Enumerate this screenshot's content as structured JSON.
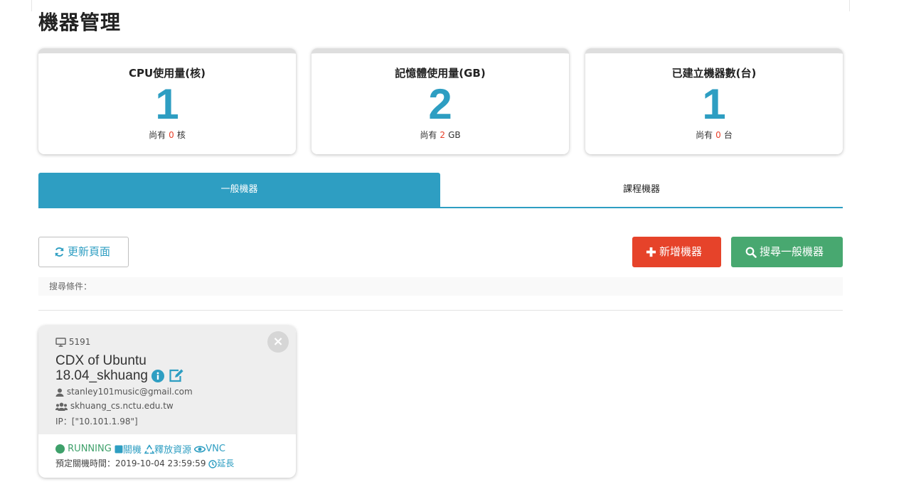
{
  "page": {
    "title": "機器管理"
  },
  "stats": [
    {
      "title": "CPU使用量(核)",
      "value": "1",
      "remain_prefix": "尚有",
      "remain_value": "0",
      "remain_unit": "核"
    },
    {
      "title": "記憶體使用量(GB)",
      "value": "2",
      "remain_prefix": "尚有",
      "remain_value": "2",
      "remain_unit": "GB"
    },
    {
      "title": "已建立機器數(台)",
      "value": "1",
      "remain_prefix": "尚有",
      "remain_value": "0",
      "remain_unit": "台"
    }
  ],
  "tabs": [
    {
      "label": "一般機器",
      "active": true
    },
    {
      "label": "課程機器",
      "active": false
    }
  ],
  "toolbar": {
    "refresh_label": "更新頁面",
    "add_label": "新增機器",
    "search_label": "搜尋一般機器"
  },
  "filter": {
    "label": "搜尋條件："
  },
  "vm": {
    "id": "5191",
    "name": "CDX of Ubuntu 18.04_skhuang",
    "email": "stanley101music@gmail.com",
    "group": "skhuang_cs.nctu.edu.tw",
    "ip": "IP：[\"10.101.1.98\"]",
    "status": "RUNNING",
    "shutdown_label": "關機",
    "release_label": "釋放資源",
    "vnc_label": "VNC",
    "schedule_label": "預定關機時間：2019-10-04 23:59:59",
    "extend_label": "延長",
    "close_label": "×"
  },
  "colors": {
    "accent": "#2e9ec2",
    "danger": "#e6432a",
    "success": "#48a870",
    "remain_number": "#e8402a"
  }
}
